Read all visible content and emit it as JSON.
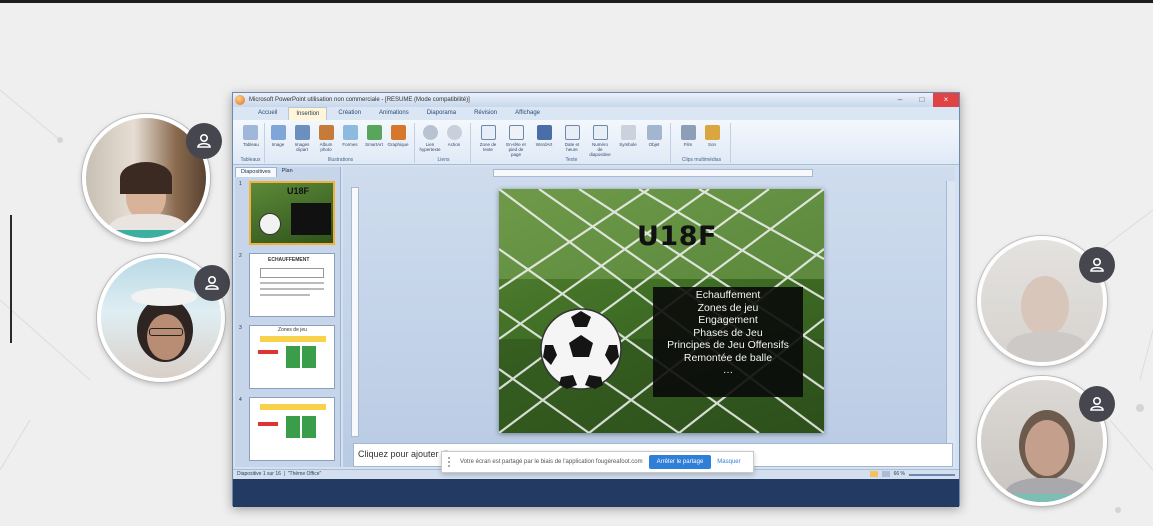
{
  "ppt": {
    "title": "Microsoft PowerPoint utilisation non commerciale - [RESUME (Mode compatibilité)]",
    "tabs": [
      "Accueil",
      "Insertion",
      "Création",
      "Animations",
      "Diaporama",
      "Révision",
      "Affichage"
    ],
    "ribbon_groups": [
      {
        "label": "Tableaux",
        "items": [
          "Tableau"
        ]
      },
      {
        "label": "Illustrations",
        "items": [
          "Image",
          "Images clipart",
          "Album photo",
          "Formes",
          "SmartArt",
          "Graphique"
        ]
      },
      {
        "label": "Liens",
        "items": [
          "Lien hypertexte",
          "Action"
        ]
      },
      {
        "label": "Texte",
        "items": [
          "Zone de texte",
          "En-tête et pied de page",
          "WordArt",
          "Date et heure",
          "Numéro de diapositive",
          "Symbole",
          "Objet"
        ]
      },
      {
        "label": "Clips multimédias",
        "items": [
          "Film",
          "Son"
        ]
      }
    ],
    "pane_tabs": [
      "Diapositives",
      "Plan"
    ],
    "thumbnail_numbers": [
      "1",
      "2",
      "3",
      "4"
    ],
    "thumb1_title": "U18F",
    "thumb2_title": "ECHAUFFEMENT",
    "thumb3_title": "Zones de jeu",
    "slide": {
      "title": "U18F",
      "agenda": [
        "Echauffement",
        "Zones de jeu",
        "Engagement",
        "Phases de Jeu",
        "Principes de Jeu Offensifs",
        "Remontée de balle",
        "…"
      ]
    },
    "notes_placeholder": "Cliquez pour ajouter di",
    "status_left": "Diapositive 1 sur 16",
    "status_theme": "\"Thème Office\"",
    "status_zoom": "66 %"
  },
  "sharebar": {
    "text": "Votre écran est partagé par le biais de l'application fougèreafoot.com",
    "stop_label": "Arrêter le partage",
    "hide_label": "Masquer"
  },
  "participants": [
    {
      "name": "participant-1"
    },
    {
      "name": "participant-2"
    },
    {
      "name": "participant-3"
    },
    {
      "name": "participant-4"
    }
  ]
}
